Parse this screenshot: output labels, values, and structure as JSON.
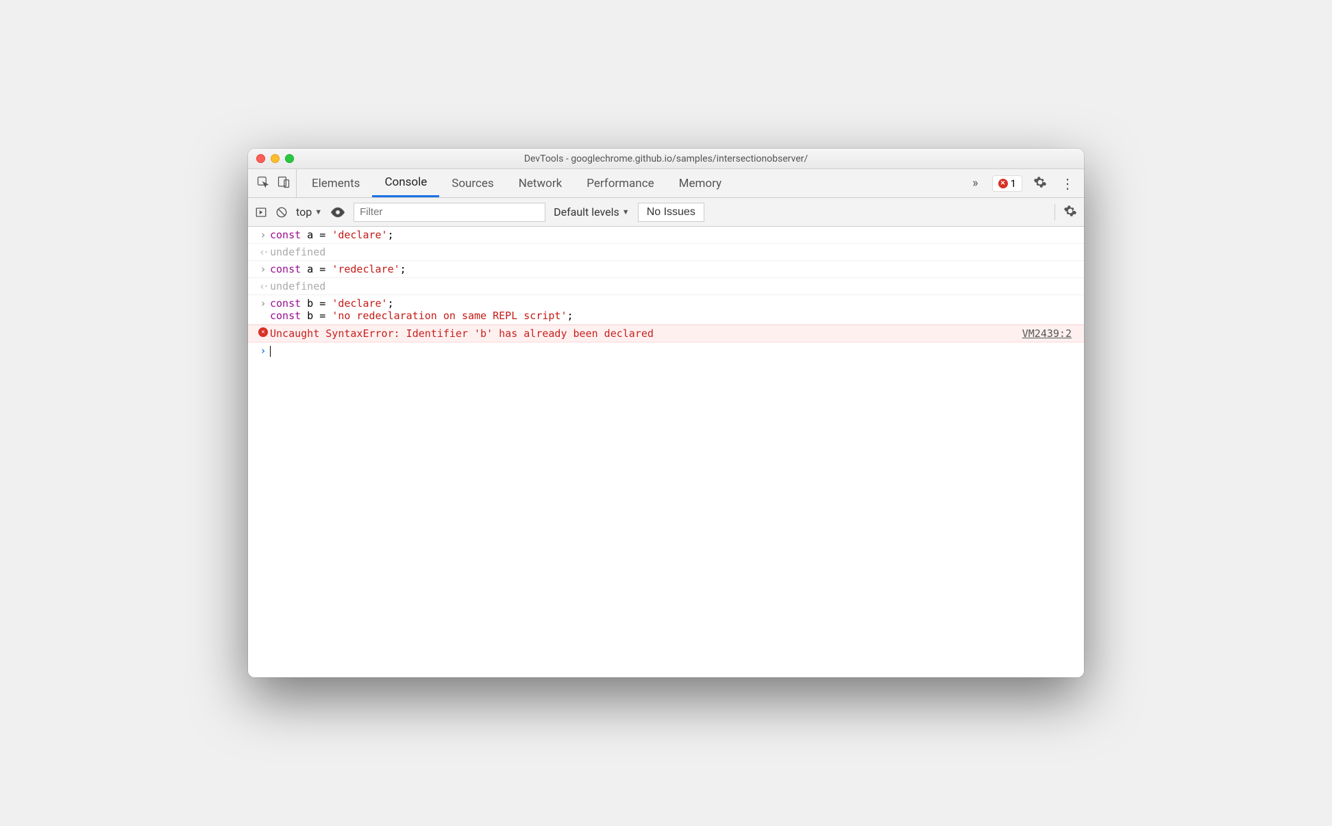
{
  "window": {
    "title": "DevTools - googlechrome.github.io/samples/intersectionobserver/"
  },
  "tabs": {
    "items": [
      "Elements",
      "Console",
      "Sources",
      "Network",
      "Performance",
      "Memory"
    ],
    "active": "Console",
    "error_count": "1"
  },
  "toolbar": {
    "context": "top",
    "filter_placeholder": "Filter",
    "filter_value": "",
    "levels": "Default levels",
    "issues": "No Issues"
  },
  "console": {
    "rows": [
      {
        "type": "in",
        "code": [
          {
            "t": "kw",
            "v": "const"
          },
          {
            "t": "p",
            "v": " a = "
          },
          {
            "t": "str",
            "v": "'declare'"
          },
          {
            "t": "p",
            "v": ";"
          }
        ]
      },
      {
        "type": "out",
        "text": "undefined"
      },
      {
        "type": "in",
        "code": [
          {
            "t": "kw",
            "v": "const"
          },
          {
            "t": "p",
            "v": " a = "
          },
          {
            "t": "str",
            "v": "'redeclare'"
          },
          {
            "t": "p",
            "v": ";"
          }
        ]
      },
      {
        "type": "out",
        "text": "undefined"
      },
      {
        "type": "in",
        "code": [
          {
            "t": "kw",
            "v": "const"
          },
          {
            "t": "p",
            "v": " b = "
          },
          {
            "t": "str",
            "v": "'declare'"
          },
          {
            "t": "p",
            "v": ";\n"
          },
          {
            "t": "kw",
            "v": "const"
          },
          {
            "t": "p",
            "v": " b = "
          },
          {
            "t": "str",
            "v": "'no redeclaration on same REPL script'"
          },
          {
            "t": "p",
            "v": ";"
          }
        ]
      },
      {
        "type": "error",
        "text": "Uncaught SyntaxError: Identifier 'b' has already been declared",
        "link": "VM2439:2"
      },
      {
        "type": "live"
      }
    ]
  }
}
